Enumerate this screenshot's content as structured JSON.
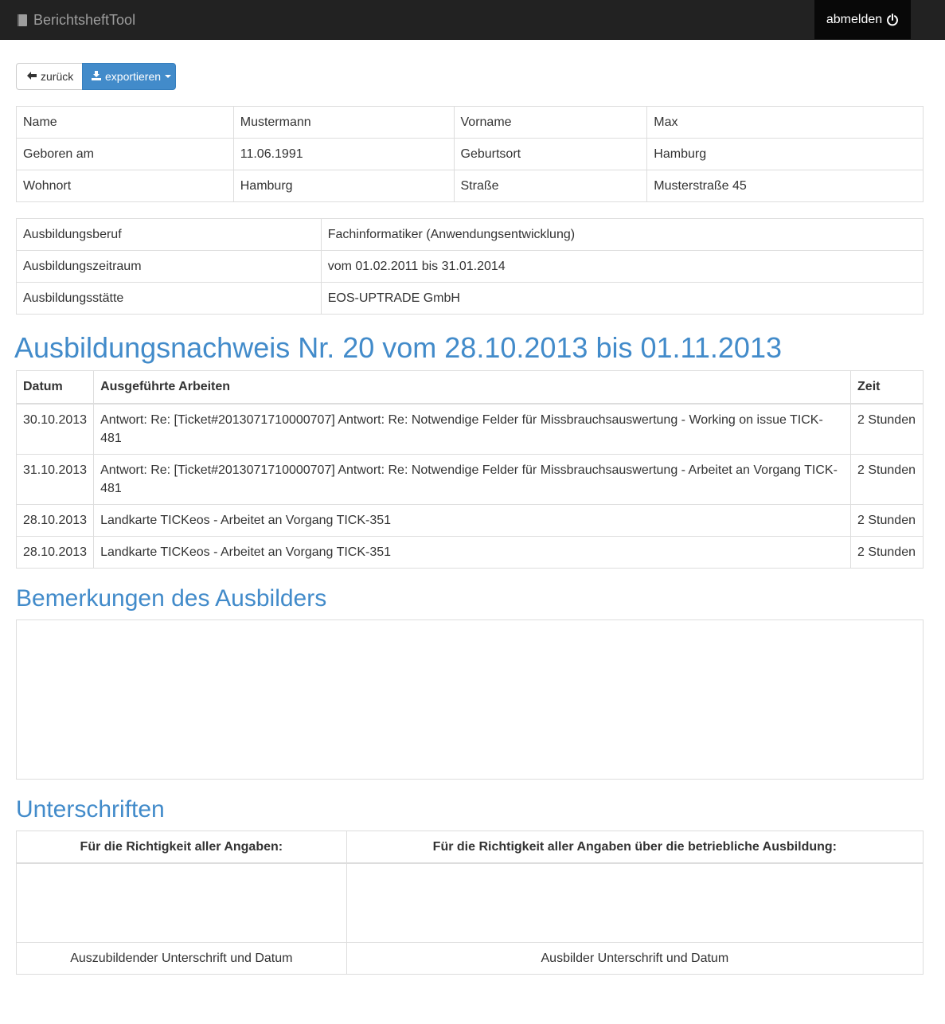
{
  "navbar": {
    "brand": "BerichtsheftTool",
    "logout_label": "abmelden"
  },
  "toolbar": {
    "back_label": "zurück",
    "export_label": "exportieren"
  },
  "person": {
    "name_label": "Name",
    "name_value": "Mustermann",
    "firstname_label": "Vorname",
    "firstname_value": "Max",
    "born_label": "Geboren am",
    "born_value": "11.06.1991",
    "birthplace_label": "Geburtsort",
    "birthplace_value": "Hamburg",
    "residence_label": "Wohnort",
    "residence_value": "Hamburg",
    "street_label": "Straße",
    "street_value": "Musterstraße 45"
  },
  "training": {
    "occupation_label": "Ausbildungsberuf",
    "occupation_value": "Fachinformatiker (Anwendungsentwicklung)",
    "period_label": "Ausbildungszeitraum",
    "period_value": "vom 01.02.2011 bis 31.01.2014",
    "company_label": "Ausbildungsstätte",
    "company_value": "EOS-UPTRADE GmbH"
  },
  "report": {
    "title": "Ausbildungsnachweis Nr. 20 vom 28.10.2013 bis 01.11.2013",
    "columns": [
      "Datum",
      "Ausgeführte Arbeiten",
      "Zeit"
    ],
    "rows": [
      {
        "date": "30.10.2013",
        "work": "Antwort: Re: [Ticket#2013071710000707] Antwort: Re: Notwendige Felder für Missbrauchsauswertung - Working on issue TICK-481",
        "time": "2 Stunden"
      },
      {
        "date": "31.10.2013",
        "work": "Antwort: Re: [Ticket#2013071710000707] Antwort: Re: Notwendige Felder für Missbrauchsauswertung - Arbeitet an Vorgang TICK-481",
        "time": "2 Stunden"
      },
      {
        "date": "28.10.2013",
        "work": "Landkarte TICKeos - Arbeitet an Vorgang TICK-351",
        "time": "2 Stunden"
      },
      {
        "date": "28.10.2013",
        "work": "Landkarte TICKeos - Arbeitet an Vorgang TICK-351",
        "time": "2 Stunden"
      }
    ]
  },
  "remarks": {
    "title": "Bemerkungen des Ausbilders"
  },
  "signatures": {
    "title": "Unterschriften",
    "header_trainee": "Für die Richtigkeit aller Angaben:",
    "header_trainer": "Für die Richtigkeit aller Angaben über die betriebliche Ausbildung:",
    "caption_trainee": "Auszubildender Unterschrift und Datum",
    "caption_trainer": "Ausbilder Unterschrift und Datum"
  },
  "colors": {
    "navbar_bg": "#222222",
    "accent": "#428bca",
    "border": "#dddddd"
  },
  "icons": [
    "book-icon",
    "power-icon",
    "arrow-left-icon",
    "export-icon",
    "caret-down-icon"
  ]
}
